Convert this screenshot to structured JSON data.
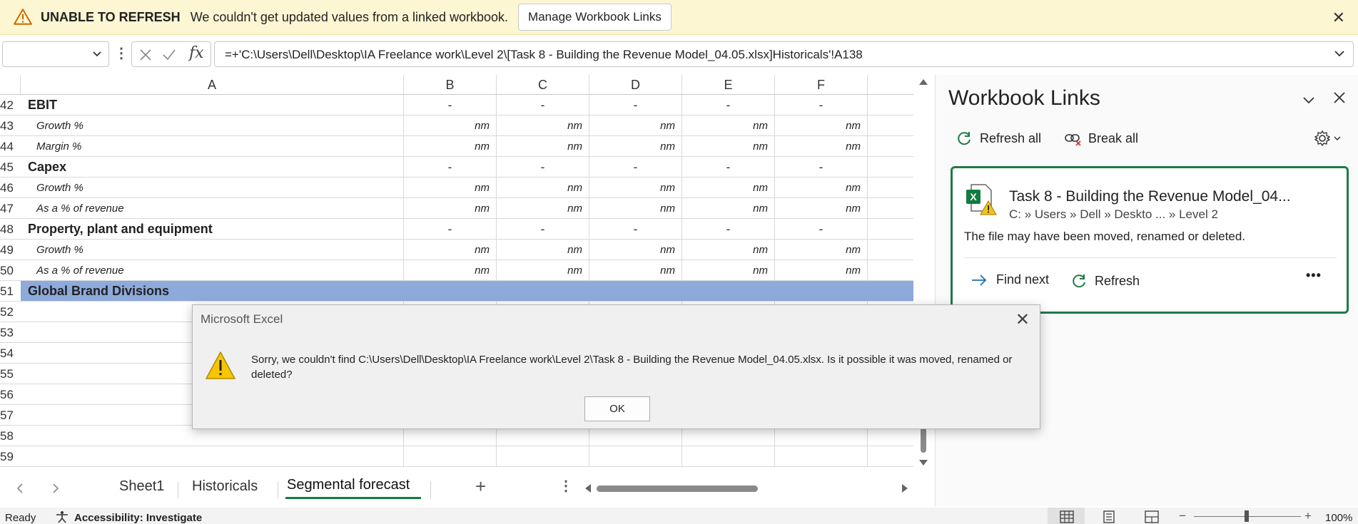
{
  "message_bar": {
    "title": "UNABLE TO REFRESH",
    "message": "We couldn't get updated values from a linked workbook.",
    "button_label": "Manage Workbook Links",
    "close_glyph": "✕",
    "icon": "warning-icon"
  },
  "formula_bar": {
    "name_box": "",
    "fx_label": "fx",
    "formula": "=+'C:\\Users\\Dell\\Desktop\\IA Freelance work\\Level 2\\[Task 8 - Building the Revenue Model_04.05.xlsx]Historicals'!A138"
  },
  "grid": {
    "columns": [
      "A",
      "B",
      "C",
      "D",
      "E",
      "F"
    ],
    "rows": [
      {
        "num": "42",
        "label": "EBIT",
        "style": "bold",
        "values": [
          "-",
          "-",
          "-",
          "-",
          "-"
        ]
      },
      {
        "num": "43",
        "label": "Growth %",
        "style": "italic",
        "values": [
          "nm",
          "nm",
          "nm",
          "nm",
          "nm"
        ]
      },
      {
        "num": "44",
        "label": "Margin %",
        "style": "italic",
        "values": [
          "nm",
          "nm",
          "nm",
          "nm",
          "nm"
        ]
      },
      {
        "num": "45",
        "label": "Capex",
        "style": "bold",
        "values": [
          "-",
          "-",
          "-",
          "-",
          "-"
        ]
      },
      {
        "num": "46",
        "label": "Growth %",
        "style": "italic",
        "values": [
          "nm",
          "nm",
          "nm",
          "nm",
          "nm"
        ]
      },
      {
        "num": "47",
        "label": "As a  % of revenue",
        "style": "italic",
        "values": [
          "nm",
          "nm",
          "nm",
          "nm",
          "nm"
        ]
      },
      {
        "num": "48",
        "label": "Property, plant and equipment",
        "style": "bold",
        "values": [
          "-",
          "-",
          "-",
          "-",
          "-"
        ]
      },
      {
        "num": "49",
        "label": "Growth %",
        "style": "italic",
        "values": [
          "nm",
          "nm",
          "nm",
          "nm",
          "nm"
        ]
      },
      {
        "num": "50",
        "label": "As a  % of revenue",
        "style": "italic",
        "values": [
          "nm",
          "nm",
          "nm",
          "nm",
          "nm"
        ]
      },
      {
        "num": "51",
        "label": "Global Brand Divisions",
        "style": "highlight",
        "values": [
          "",
          "",
          "",
          "",
          ""
        ]
      },
      {
        "num": "52",
        "label": "",
        "style": "empty",
        "values": [
          "",
          "",
          "",
          "",
          ""
        ]
      },
      {
        "num": "53",
        "label": "",
        "style": "empty",
        "values": [
          "",
          "",
          "",
          "",
          ""
        ]
      },
      {
        "num": "54",
        "label": "",
        "style": "empty",
        "values": [
          "",
          "",
          "",
          "",
          ""
        ]
      },
      {
        "num": "55",
        "label": "",
        "style": "empty",
        "values": [
          "",
          "",
          "",
          "",
          ""
        ]
      },
      {
        "num": "56",
        "label": "",
        "style": "empty",
        "values": [
          "",
          "",
          "",
          "",
          ""
        ]
      },
      {
        "num": "57",
        "label": "",
        "style": "empty",
        "values": [
          "",
          "",
          "",
          "",
          ""
        ]
      },
      {
        "num": "58",
        "label": "",
        "style": "empty",
        "values": [
          "",
          "",
          "",
          "",
          ""
        ]
      },
      {
        "num": "59",
        "label": "",
        "style": "empty",
        "values": [
          "",
          "",
          "",
          "",
          ""
        ]
      }
    ]
  },
  "sheet_tabs": {
    "tabs": [
      "Sheet1",
      "Historicals",
      "Segmental forecast"
    ],
    "active": "Segmental forecast",
    "add_glyph": "+"
  },
  "status_bar": {
    "status": "Ready",
    "accessibility": "Accessibility: Investigate",
    "zoom": "100%"
  },
  "pane": {
    "title": "Workbook Links",
    "refresh_all": "Refresh all",
    "break_all": "Break all",
    "link": {
      "name": "Task 8 - Building the Revenue Model_04...",
      "path": "C: » Users » Dell » Deskto ... » Level 2",
      "message": "The file may have been moved, renamed or deleted.",
      "find_next": "Find next",
      "refresh": "Refresh",
      "more": "•••"
    }
  },
  "dialog": {
    "title": "Microsoft Excel",
    "message": "Sorry, we couldn't find C:\\Users\\Dell\\Desktop\\IA Freelance work\\Level 2\\Task 8 - Building the Revenue Model_04.05.xlsx. Is it possible it was moved, renamed or deleted?",
    "ok_label": "OK",
    "close_glyph": "✕"
  },
  "colors": {
    "message_bar_bg": "#fdf6d3",
    "highlight_row": "#8eaadb",
    "pane_card_border": "#1f7a48",
    "excel_green": "#107c41",
    "warning_yellow": "#f2c31b"
  }
}
